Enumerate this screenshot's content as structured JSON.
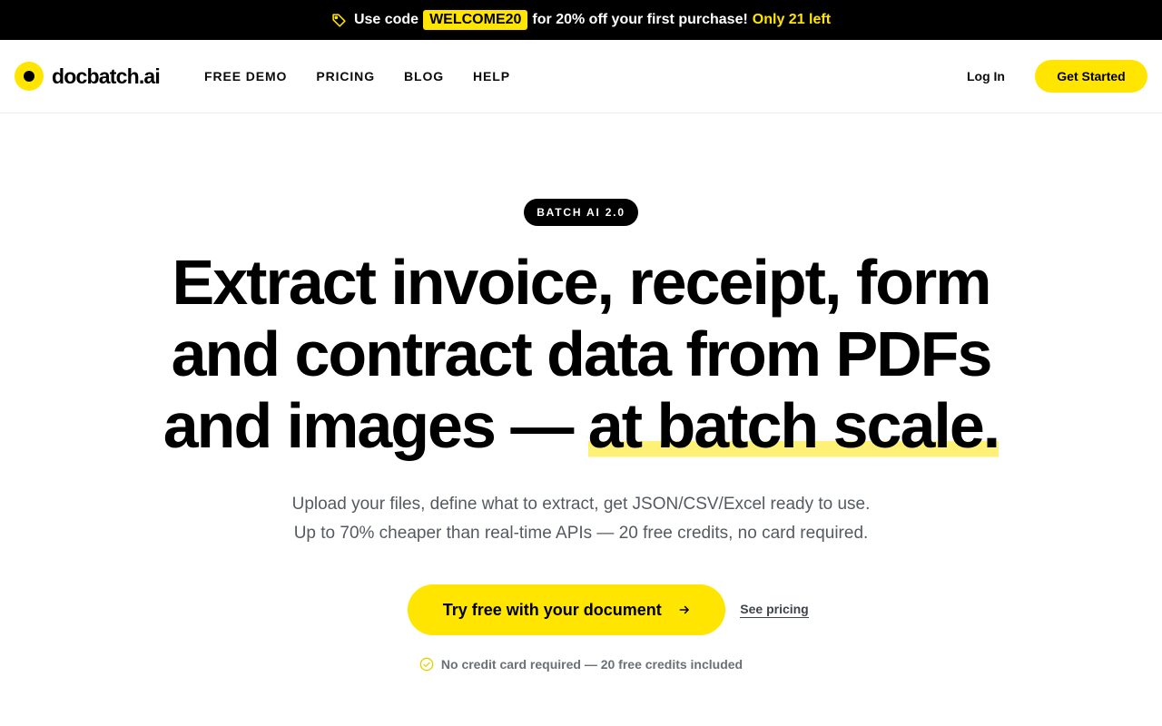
{
  "promo": {
    "prefix": "Use code",
    "code": "WELCOME20",
    "message": "for 20% off your first purchase!",
    "remaining": "Only 21 left",
    "icon": "tag-icon"
  },
  "header": {
    "logo_text": "docbatch.ai",
    "nav": [
      "FREE DEMO",
      "PRICING",
      "BLOG",
      "HELP"
    ],
    "login_label": "Log In",
    "cta_label": "Get Started"
  },
  "hero": {
    "badge": "BATCH AI 2.0",
    "headline_main": "Extract invoice, receipt, form and contract data from PDFs and images — ",
    "headline_highlight": "at batch scale.",
    "sub_line1": "Upload your files, define what to extract, get JSON/CSV/Excel ready to use.",
    "sub_line2": "Up to 70% cheaper than real-time APIs — 20 free credits, no card required.",
    "cta_label": "Try free with your document",
    "secondary_link": "See pricing",
    "note": "No credit card required — 20 free credits included"
  },
  "colors": {
    "accent": "#ffe500",
    "highlight": "#fff176",
    "dark": "#000000",
    "muted_text": "#555a61"
  }
}
